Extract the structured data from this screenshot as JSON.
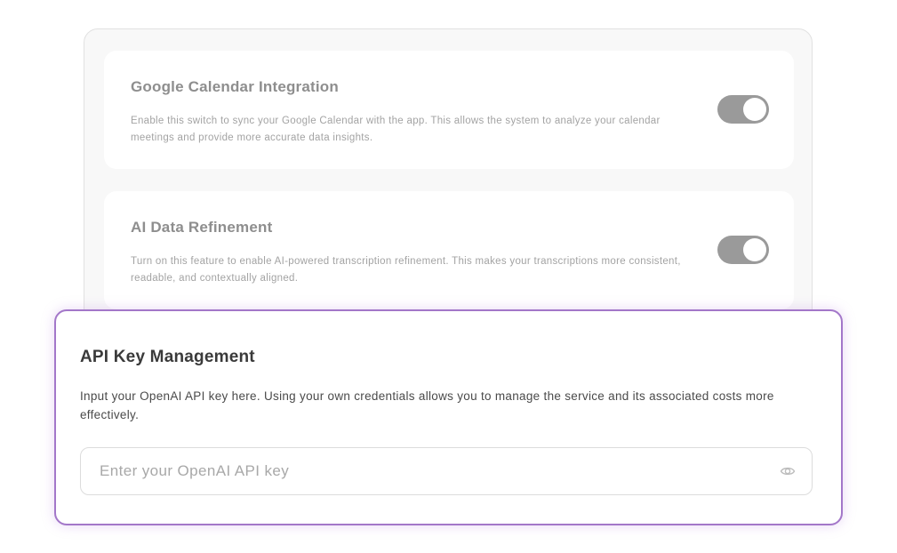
{
  "settings": {
    "google_calendar": {
      "title": "Google Calendar Integration",
      "description": "Enable this switch to sync your Google Calendar with the app. This allows the system to analyze your calendar meetings and provide more accurate data insights.",
      "toggle_on": true
    },
    "ai_refinement": {
      "title": "AI Data Refinement",
      "description": "Turn on this feature to enable AI-powered transcription refinement. This makes your transcriptions more consistent, readable, and contextually aligned.",
      "toggle_on": true
    }
  },
  "api_key": {
    "title": "API Key Management",
    "description": "Input your OpenAI API key here. Using your own credentials allows you to manage the service and its associated costs more effectively.",
    "input_value": "",
    "placeholder": "Enter your OpenAI API key",
    "visibility_icon": "eye-icon"
  },
  "colors": {
    "accent_border": "#a377c9",
    "toggle_track": "#9a9a9a"
  }
}
